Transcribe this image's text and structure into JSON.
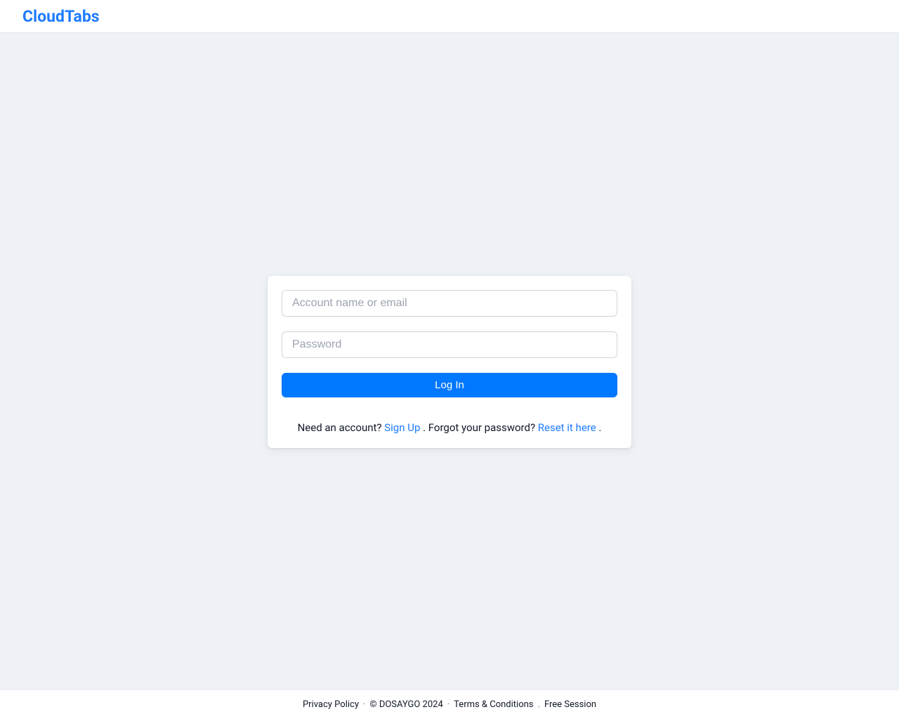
{
  "header": {
    "brand": "CloudTabs"
  },
  "form": {
    "account_placeholder": "Account name or email",
    "password_placeholder": "Password",
    "submit_label": "Log In"
  },
  "helper": {
    "need_account": "Need an account? ",
    "signup": "Sign Up",
    "sep1": " . ",
    "forgot": "Forgot your password? ",
    "reset": "Reset it here",
    "sep2": " ."
  },
  "footer": {
    "privacy": "Privacy Policy",
    "dot": " · ",
    "copyright": "© DOSAYGO 2024",
    "terms": "Terms & Conditions",
    "dot2": " . ",
    "free_session": "Free Session"
  }
}
